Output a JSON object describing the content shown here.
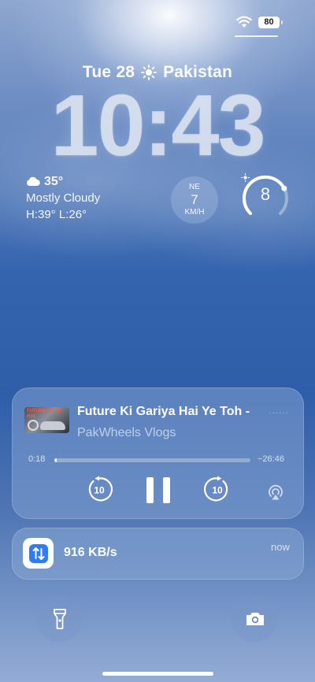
{
  "status_bar": {
    "battery": "80",
    "icons": [
      "wifi-icon",
      "battery-icon"
    ]
  },
  "lock_screen": {
    "date": "Tue 28",
    "location": "Pakistan",
    "time": "10:43"
  },
  "weather": {
    "temperature": "35°",
    "condition": "Mostly Cloudy",
    "high_low": "H:39° L:26°",
    "icon": "cloud-icon"
  },
  "wind": {
    "direction": "NE",
    "speed": "7",
    "unit": "KM/H"
  },
  "uv_index": {
    "value": "8",
    "level_fraction": 0.73
  },
  "now_playing": {
    "artwork_text": "FUTURE TO YE HAI",
    "title": "Future Ki Gariya Hai Ye Toh -",
    "artist": "PakWheels Vlogs",
    "menu_dots": "······",
    "elapsed": "0:18",
    "remaining": "−26:46",
    "progress_fraction": 0.011,
    "skip_back_seconds": "10",
    "skip_forward_seconds": "10"
  },
  "notification": {
    "text": "916 KB/s",
    "time": "now",
    "icon": "transfer-arrows-icon"
  },
  "buttons": [
    "flashlight-icon",
    "camera-icon"
  ]
}
